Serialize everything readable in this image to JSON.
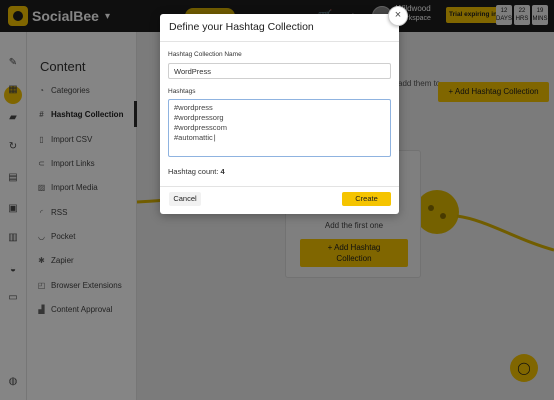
{
  "app": {
    "name": "SocialBee",
    "workspace_name": "Wildwood",
    "workspace_label": "Workspace",
    "trial_label": "Trial expiring in",
    "countdown": [
      {
        "value": "12",
        "unit": "DAYS"
      },
      {
        "value": "22",
        "unit": "HRS"
      },
      {
        "value": "19",
        "unit": "MINS"
      }
    ],
    "accent_color": "#f5c400",
    "topbar_color": "#1d1d1d"
  },
  "sidebar": {
    "title": "Content",
    "items": [
      {
        "label": "Categories",
        "icon": "categories-icon"
      },
      {
        "label": "Hashtag Collection",
        "icon": "hashtag-icon",
        "active": true
      },
      {
        "label": "Import CSV",
        "icon": "file-icon"
      },
      {
        "label": "Import Links",
        "icon": "link-icon"
      },
      {
        "label": "Import Media",
        "icon": "media-icon"
      },
      {
        "label": "RSS",
        "icon": "rss-icon"
      },
      {
        "label": "Pocket",
        "icon": "pocket-icon"
      },
      {
        "label": "Zapier",
        "icon": "zapier-icon"
      },
      {
        "label": "Browser Extensions",
        "icon": "extension-icon"
      },
      {
        "label": "Content Approval",
        "icon": "approval-icon"
      }
    ]
  },
  "main": {
    "intro_text": "add them to",
    "add_collection_label": "+ Add Hashtag Collection",
    "empty_text": "Add the first one",
    "add_collection_card_line1": "+ Add Hashtag",
    "add_collection_card_line2": "Collection"
  },
  "modal": {
    "title": "Define your Hashtag Collection",
    "name_label": "Hashtag Collection Name",
    "name_value": "WordPress",
    "hashtags_label": "Hashtags",
    "hashtags": [
      "#wordpress",
      "#wordpressorg",
      "#wordpresscom",
      "#automattic"
    ],
    "count_label": "Hashtag count:",
    "count_value": "4",
    "cancel_label": "Cancel",
    "create_label": "Create",
    "close_glyph": "×"
  }
}
